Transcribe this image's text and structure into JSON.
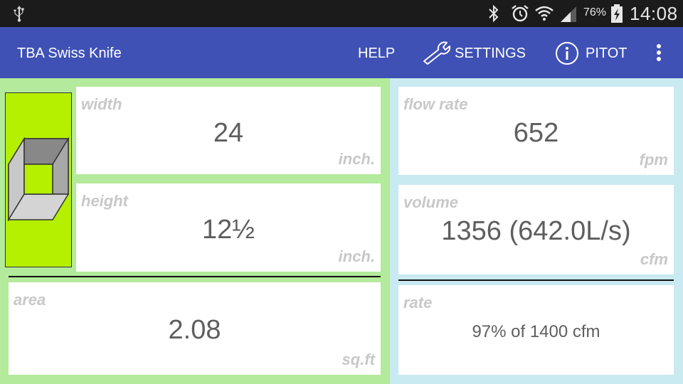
{
  "statusbar": {
    "battery_percent": "76%",
    "clock": "14:08"
  },
  "appbar": {
    "title": "TBA Swiss Knife",
    "help_label": "HELP",
    "settings_label": "SETTINGS",
    "pitot_label": "PITOT"
  },
  "left": {
    "width": {
      "label": "width",
      "value": "24",
      "unit": "inch."
    },
    "height": {
      "label": "height",
      "value": "12½",
      "unit": "inch."
    },
    "area": {
      "label": "area",
      "value": "2.08",
      "unit": "sq.ft"
    }
  },
  "right": {
    "flow_rate": {
      "label": "flow rate",
      "value": "652",
      "unit": "fpm"
    },
    "volume": {
      "label": "volume",
      "value": "1356 (642.0L/s)",
      "unit": "cfm"
    },
    "rate": {
      "label": "rate",
      "value": "97% of 1400 cfm"
    }
  },
  "colors": {
    "appbar": "#3f51b5",
    "left_panel": "#b3ea9b",
    "right_panel": "#c9eaf0",
    "shape_fill": "#b4f000"
  },
  "icons": [
    "usb-icon",
    "bluetooth-icon",
    "alarm-icon",
    "wifi-icon",
    "signal-icon",
    "battery-icon",
    "wrench-icon",
    "info-icon",
    "overflow-menu-icon",
    "rectangular-duct-icon"
  ]
}
